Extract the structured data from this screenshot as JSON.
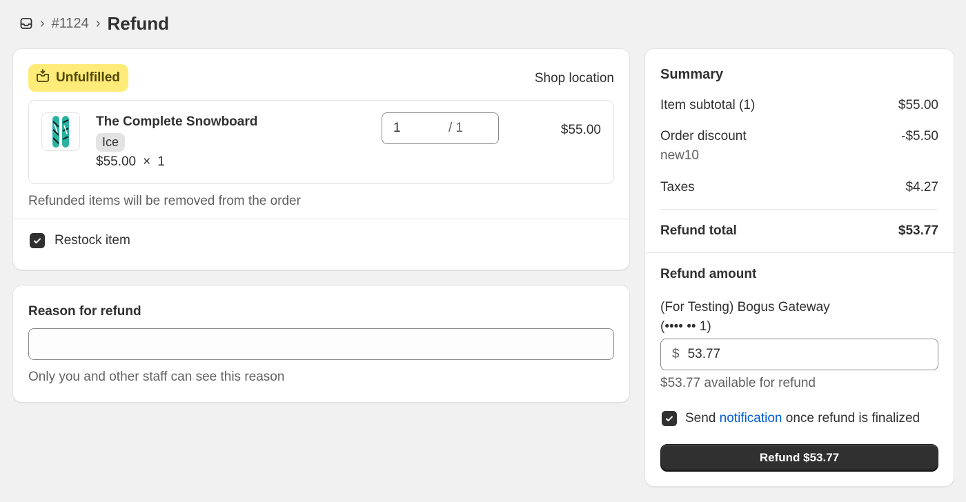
{
  "breadcrumb": {
    "icon": "orders-inbox-icon",
    "separator": "›",
    "order": "#1124",
    "title": "Refund"
  },
  "fulfillment": {
    "status": "Unfulfilled",
    "status_icon": "unfulfilled-box-icon",
    "status_color": "#ffeb78",
    "location": "Shop location"
  },
  "line_item": {
    "name": "The Complete Snowboard",
    "variant": "Ice",
    "unit_price": "$55.00",
    "times": "×",
    "quantity_ordered": "1",
    "refund_qty": "1",
    "refund_qty_max": "/ 1",
    "line_total": "$55.00"
  },
  "refund_note": "Refunded items will be removed from the order",
  "restock": {
    "label": "Restock item",
    "checked": true
  },
  "reason": {
    "label": "Reason for refund",
    "value": "",
    "help": "Only you and other staff can see this reason"
  },
  "summary": {
    "title": "Summary",
    "subtotal_label": "Item subtotal (1)",
    "subtotal_value": "$55.00",
    "discount_label": "Order discount",
    "discount_value": "-$5.50",
    "discount_code": "new10",
    "taxes_label": "Taxes",
    "taxes_value": "$4.27",
    "total_label": "Refund total",
    "total_value": "$53.77"
  },
  "refund_amount": {
    "title": "Refund amount",
    "gateway_line1": "(For Testing) Bogus Gateway",
    "gateway_line2": "(•••• •• 1)",
    "currency": "$",
    "value": "53.77",
    "available": "$53.77 available for refund"
  },
  "notification": {
    "prefix": "Send ",
    "link": "notification",
    "suffix": " once refund is finalized",
    "checked": true,
    "link_color": "#005bd3"
  },
  "refund_button": {
    "label": "Refund $53.77"
  }
}
